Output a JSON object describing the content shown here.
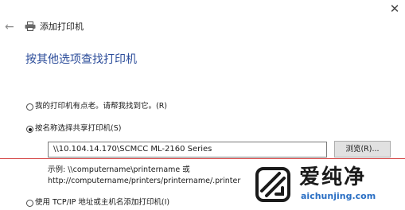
{
  "titlebar": {
    "close_glyph": "✕"
  },
  "header": {
    "back_glyph": "←",
    "title": "添加打印机"
  },
  "heading": "按其他选项查找打印机",
  "options": {
    "old_printer": {
      "label": "我的打印机有点老。请帮我找到它。(R)",
      "selected": false
    },
    "share_name": {
      "label": "按名称选择共享打印机(S)",
      "selected": true
    },
    "tcp_ip": {
      "label": "使用 TCP/IP 地址或主机名添加打印机(I)",
      "selected": false
    }
  },
  "share_input": {
    "value": "\\\\10.104.14.170\\SCMCC ML-2160 Series"
  },
  "browse_button": "浏览(R)...",
  "example": {
    "line1": "示例: \\\\computername\\printername 或",
    "line2": "http://computername/printers/printername/.printer"
  },
  "watermark": {
    "brand_cn": "爱纯净",
    "url": "aichunjing.com"
  },
  "colors": {
    "heading": "#2b4c9a",
    "divider": "#d23b3b",
    "watermark_url": "#2a6fc4"
  },
  "icons": [
    "close-icon",
    "back-arrow-icon",
    "printer-icon",
    "watermark-logo"
  ]
}
